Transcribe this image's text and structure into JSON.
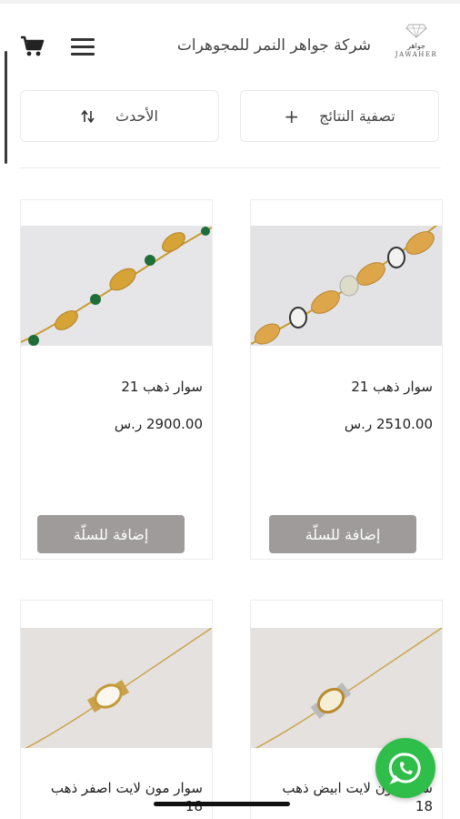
{
  "header": {
    "store_name": "شركة جواهر النمر للمجوهرات",
    "logo_text": "JAWAHER",
    "logo_arabic": "جواهر",
    "cart_icon": "cart-icon",
    "menu_icon": "hamburger-menu-icon"
  },
  "toolbar": {
    "filter_label": "تصفية النتائج",
    "filter_icon": "plus-icon",
    "sort_label": "الأحدث",
    "sort_icon": "sort-arrows-icon"
  },
  "products": [
    {
      "name": "سوار ذهب 21",
      "price": "2510.00 ر.س",
      "add_label": "إضافة للسلّة"
    },
    {
      "name": "سوار ذهب 21",
      "price": "2900.00 ر.س",
      "add_label": "إضافة للسلّة"
    },
    {
      "name": "سوار مون لايت ابيض ذهب 18"
    },
    {
      "name": "سوار مون لايت اصفر ذهب 18"
    }
  ],
  "floating": {
    "whatsapp_icon": "whatsapp-icon"
  },
  "colors": {
    "button_bg": "#9f9b9b",
    "whatsapp": "#2fbe4a",
    "gold": "#d9a93a"
  }
}
